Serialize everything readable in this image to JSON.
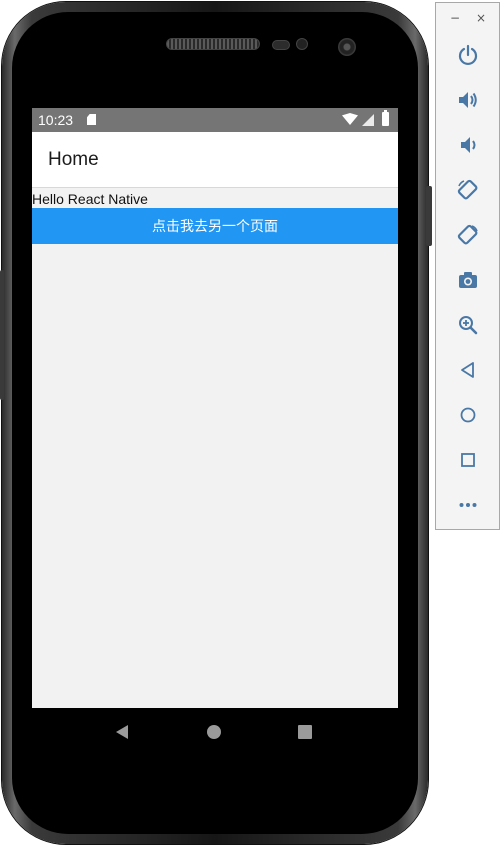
{
  "status_bar": {
    "time": "10:23"
  },
  "app_header": {
    "title": "Home"
  },
  "content": {
    "greeting": "Hello React Native",
    "nav_button_label": "点击我去另一个页面"
  },
  "colors": {
    "primary_button": "#2196f3",
    "status_bar": "#757575",
    "screen_background": "#f2f2f2",
    "toolbar_icon": "#4a78a6"
  },
  "emulator_toolbar": {
    "window_controls": {
      "minimize": "−",
      "close": "×"
    },
    "buttons": [
      {
        "id": "power",
        "icon": "power-icon"
      },
      {
        "id": "volume-up",
        "icon": "volume-up-icon"
      },
      {
        "id": "volume-down",
        "icon": "volume-down-icon"
      },
      {
        "id": "rotate-left",
        "icon": "rotate-left-icon"
      },
      {
        "id": "rotate-right",
        "icon": "rotate-right-icon"
      },
      {
        "id": "screenshot",
        "icon": "camera-icon"
      },
      {
        "id": "zoom",
        "icon": "zoom-in-icon"
      },
      {
        "id": "back",
        "icon": "back-triangle-icon"
      },
      {
        "id": "home",
        "icon": "home-circle-icon"
      },
      {
        "id": "overview",
        "icon": "overview-square-icon"
      },
      {
        "id": "more",
        "icon": "more-dots-icon"
      }
    ]
  }
}
